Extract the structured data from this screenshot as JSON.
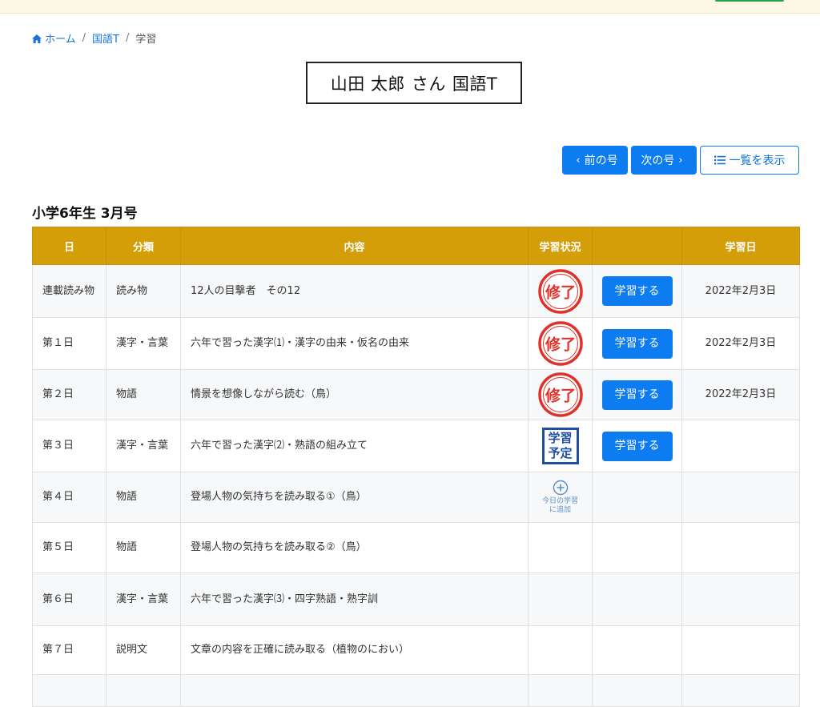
{
  "breadcrumb": {
    "home": "ホーム",
    "subject": "国語T",
    "current": "学習",
    "separator": "/"
  },
  "header": {
    "student_name": "山田 太郎",
    "honorific": "さん",
    "course": "国語T"
  },
  "nav": {
    "prev_label": "前の号",
    "next_label": "次の号",
    "list_label": "一覧を表示",
    "prev_chevron": "‹",
    "next_chevron": "›"
  },
  "issue": {
    "title": "小学6年生 3月号"
  },
  "table": {
    "headers": {
      "day": "日",
      "category": "分類",
      "content": "内容",
      "status": "学習状況",
      "action": "",
      "date": "学習日"
    },
    "study_button_label": "学習する",
    "stamp_done_text": "修了",
    "stamp_plan_lines": [
      "学習",
      "予定"
    ],
    "add_today_lines": [
      "今日の学習",
      "に追加"
    ],
    "rows": [
      {
        "day": "連載読み物",
        "category": "読み物",
        "content": "12人の目撃者　その12",
        "status": "done",
        "has_button": true,
        "date": "2022年2月3日"
      },
      {
        "day": "第１日",
        "category": "漢字・言葉",
        "content": "六年で習った漢字⑴・漢字の由来・仮名の由来",
        "status": "done",
        "has_button": true,
        "date": "2022年2月3日"
      },
      {
        "day": "第２日",
        "category": "物語",
        "content": "情景を想像しながら読む（鳥）",
        "status": "done",
        "has_button": true,
        "date": "2022年2月3日"
      },
      {
        "day": "第３日",
        "category": "漢字・言葉",
        "content": "六年で習った漢字⑵・熟語の組み立て",
        "status": "planned",
        "has_button": true,
        "date": ""
      },
      {
        "day": "第４日",
        "category": "物語",
        "content": "登場人物の気持ちを読み取る①（鳥）",
        "status": "add",
        "has_button": false,
        "date": ""
      },
      {
        "day": "第５日",
        "category": "物語",
        "content": "登場人物の気持ちを読み取る②（鳥）",
        "status": "none",
        "has_button": false,
        "date": ""
      },
      {
        "day": "第６日",
        "category": "漢字・言葉",
        "content": "六年で習った漢字⑶・四字熟語・熟字訓",
        "status": "none",
        "has_button": false,
        "date": ""
      },
      {
        "day": "第７日",
        "category": "説明文",
        "content": "文章の内容を正確に読み取る（植物のにおい）",
        "status": "none",
        "has_button": false,
        "date": ""
      },
      {
        "day": "",
        "category": "",
        "content": "",
        "status": "none",
        "has_button": false,
        "date": ""
      }
    ]
  },
  "colors": {
    "header_bg": "#d49e09",
    "primary": "#0d7cf0",
    "stamp_red": "#e0312a",
    "stamp_blue": "#1f4ea3"
  },
  "icons": {
    "home": "home-icon",
    "list": "list-icon",
    "add": "plus-circle-icon"
  }
}
